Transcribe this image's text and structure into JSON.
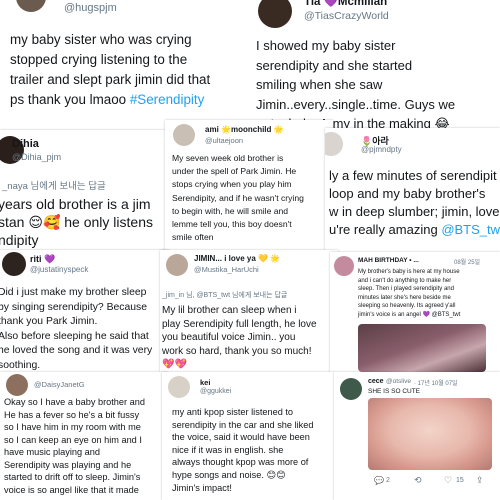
{
  "colors": {
    "link": "#1da1f2",
    "muted": "#657786",
    "text": "#14171a",
    "heart": "#9b59b6"
  },
  "tweets": {
    "t1": {
      "handle": "@hugspjm",
      "text_a": "my baby sister who was crying\nstopped crying listening to the\ntrailer and slept park jimin did that\nps thank you lmaoo ",
      "hashtag": "#Serendipity"
    },
    "t2": {
      "name": "Tia 💜Mcmillan",
      "handle": "@TiasCrazyWorld",
      "text": "I showed my baby sister\nserendipity and she started\nsmiling when she saw\nJimin..every..single..time. Guys we\ngot a baby Army in the making 😂"
    },
    "t3": {
      "name": "Dihia",
      "handle": "@Dihia_pjm",
      "reply_tag": "_naya 님에게 보내는 답글",
      "line1": "years old brother is a jim",
      "line2": "stan 😌🥰 he only listens",
      "line3": "ndipity"
    },
    "t4": {
      "name": "ami 🌟moonchild 🌟",
      "handle": "@ultaejoon",
      "text": "My seven week old brother is\nunder the spell of Park Jimin. He\nstops crying when you play him\nSerendipity, and if he wasn't crying\nto begin with, he will smile and\nlemme tell you, this boy doesn't\nsmile often"
    },
    "t5": {
      "name": "🌷아라",
      "handle": "@pjmndpty",
      "line1": "ly a few minutes of serendipit",
      "line2": " loop and my baby brother's",
      "line3": "w in deep slumber; jimin, love,",
      "line4_a": "u're really amazing ",
      "line4_link": "@BTS_twt"
    },
    "t6": {
      "name": "riti 💜",
      "handle": "@justatinyspeck",
      "text": "Did i just make my brother sleep\nby singing serendipity? Because\nthank you Park Jimin.\nAlso before sleeping he said that\nhe loved the song and it was very\nsoothing."
    },
    "t7": {
      "name": "JIMIN... i love ya 💛 🌟",
      "handle": "@Mustika_HarUchi",
      "reply_tag": "_jim_in 님, @BTS_twt 님에게 보내는 답글",
      "text": "My lil brother can sleep when i\nplay Serendipity full length, he love\nyou beautiful voice Jimin.. you\nwork so hard, thank you so much!\n💖💖"
    },
    "t8": {
      "name": "MAH BIRTHDAY • ...",
      "date": "08월 25일",
      "handle": "@...",
      "text": "My brother's baby is here at my house\nand i can't do anything to make her\nsleep. Then i played serendipity and\nminutes later she's here beside me\nsleeping so heavenly. Its agreed y'all\njimin's voice is an angel 💜 @BTS_twt"
    },
    "t9": {
      "handle": "@DaisyJanetG",
      "text": "Okay so I have a baby brother and\nHe has a fever so he's a bit fussy\nso I have him in my room with me\nso I can keep an eye on him and I\nhave music playing and\nSerendipity was playing and he\nstarted to drift off to sleep. Jimin's\nvoice is so angel like that it made"
    },
    "t10": {
      "name": "kei",
      "handle": "@ggukkei",
      "text": "my anti kpop sister listened to\nserendipity in the car and she liked\nthe voice, said it would have been\nnice if it was in english. she\nalways thought kpop was more of\nhype songs and noise. 😊😊\nJimin's impact!"
    },
    "t11": {
      "name": "cece",
      "handle": "@otslive",
      "date": "· 17년 10월 07일",
      "caption": "SHE IS SO CUTE",
      "reply_count": "2",
      "like_count": "15"
    }
  }
}
